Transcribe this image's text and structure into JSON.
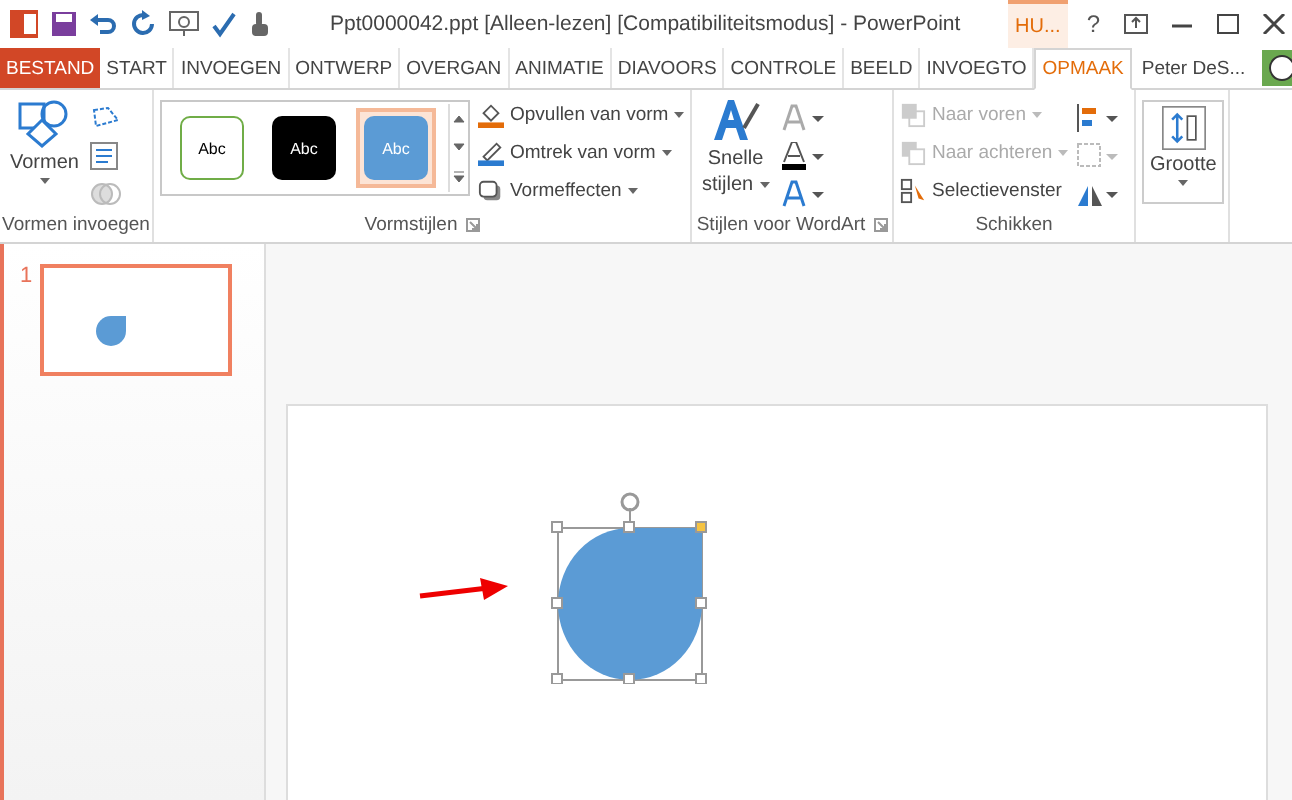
{
  "window": {
    "title": "Ppt0000042.ppt [Alleen-lezen] [Compatibiliteitsmodus] - PowerPoint",
    "contextual_tab": "HU...",
    "help": "?"
  },
  "tabs": [
    {
      "label": "BESTAND",
      "kind": "file",
      "selected": false
    },
    {
      "label": "START",
      "kind": "tab",
      "selected": false
    },
    {
      "label": "INVOEGEN",
      "kind": "tab",
      "selected": false
    },
    {
      "label": "ONTWERP",
      "kind": "tab",
      "selected": false
    },
    {
      "label": "OVERGAN",
      "kind": "tab",
      "selected": false
    },
    {
      "label": "ANIMATIE",
      "kind": "tab",
      "selected": false
    },
    {
      "label": "DIAVOORS",
      "kind": "tab",
      "selected": false
    },
    {
      "label": "CONTROLE",
      "kind": "tab",
      "selected": false
    },
    {
      "label": "BEELD",
      "kind": "tab",
      "selected": false
    },
    {
      "label": "INVOEGTO",
      "kind": "tab",
      "selected": false
    },
    {
      "label": "OPMAAK",
      "kind": "tab",
      "selected": true
    }
  ],
  "user": "Peter DeS...",
  "ribbon": {
    "insert_shapes": {
      "label": "Vormen invoegen",
      "shapes_button": "Vormen"
    },
    "shape_styles": {
      "label": "Vormstijlen",
      "gallery": [
        {
          "text": "Abc",
          "kind": "outline",
          "selected": false
        },
        {
          "text": "Abc",
          "kind": "dark",
          "selected": false
        },
        {
          "text": "Abc",
          "kind": "blue",
          "selected": true
        }
      ],
      "commands": [
        {
          "label": "Opvullen van vorm",
          "kind": "fill"
        },
        {
          "label": "Omtrek van vorm",
          "kind": "outline"
        },
        {
          "label": "Vormeffecten",
          "kind": "effects"
        }
      ]
    },
    "wordart": {
      "label": "Stijlen voor WordArt",
      "quick_styles": [
        "Snelle",
        "stijlen"
      ]
    },
    "arrange": {
      "label": "Schikken",
      "commands": [
        {
          "label": "Naar voren",
          "kind": "forward",
          "disabled": true
        },
        {
          "label": "Naar achteren",
          "kind": "backward",
          "disabled": true
        },
        {
          "label": "Selectievenster",
          "kind": "pane",
          "disabled": false
        }
      ]
    },
    "size": {
      "label": "Grootte"
    }
  },
  "slides": [
    {
      "number": "1",
      "selected": true
    }
  ]
}
